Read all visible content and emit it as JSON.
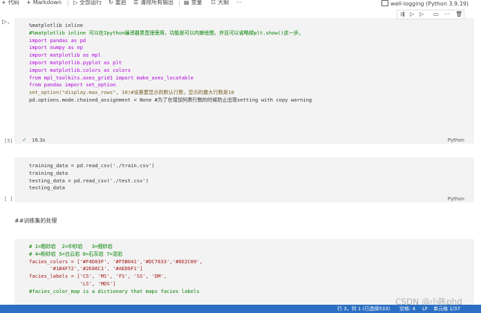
{
  "toolbar": {
    "code_label": "代码",
    "markdown_label": "Markdown",
    "run_all_label": "全部运行",
    "restart_label": "重启",
    "clear_outputs_label": "清除所有输出",
    "variables_label": "变量",
    "outline_label": "大纲",
    "more_label": "···",
    "kernel_label": "well-logging (Python 3.9.19)"
  },
  "cell1": {
    "lines": [
      "%matplotlib inline",
      "#%matplotlib inline 可以在Ipython编译器里直接使用，功能是可以内嵌绘图，并且可以省略掉plt.show()这一步。",
      "import pandas as pd",
      "import numpy as np",
      "import matplotlib as mpl",
      "import matplotlib.pyplot as plt",
      "import matplotlib.colors as colors",
      "from mpl_toolkits.axes_grid1 import make_axes_locatable",
      "from pandas import set_option",
      "set_option(\"display.max_rows\", 10)#设置要显示的默认行数，显示的最大行数是10",
      "pd.options.mode.chained_assignment = None #为了在增加列表行数的时候防止出现setting with copy warning"
    ],
    "exec_count": "[5]",
    "duration": "16.3s",
    "language": "Python"
  },
  "cell2": {
    "lines": [
      "training_data = pd.read_csv('./train.csv')",
      "training_data",
      "testing_data = pd.read_csv('./test.csv')",
      "testing_data"
    ],
    "exec_count": "[ ]",
    "language": "Python"
  },
  "markdown": {
    "text": "##训练集的处理"
  },
  "cell3": {
    "lines": [
      "# 1=粗砂岩  2=中砂岩   3=细砂岩",
      "# 4=粉砂岩 5=白云岩 6=石灰岩 7=泥岩",
      "facies_colors = ['#F4D03F', '#F5B041','#DC7633','#6E2C00',",
      "       '#1B4F72','#2E86C1', '#AED6F1']",
      "",
      "facies_labels = ['CS', 'MS', 'FS', 'SS', 'DM',",
      "                 'LS', 'MDS']",
      "#facies_color_map is a dictionary that maps facies labels"
    ]
  },
  "statusbar": {
    "position": "行 3，列 1 (已选择533)",
    "spaces": "空格: 4",
    "eol": "LF",
    "cell_info": "单元格 1/37"
  },
  "watermark": "CSDN @小陈phd"
}
